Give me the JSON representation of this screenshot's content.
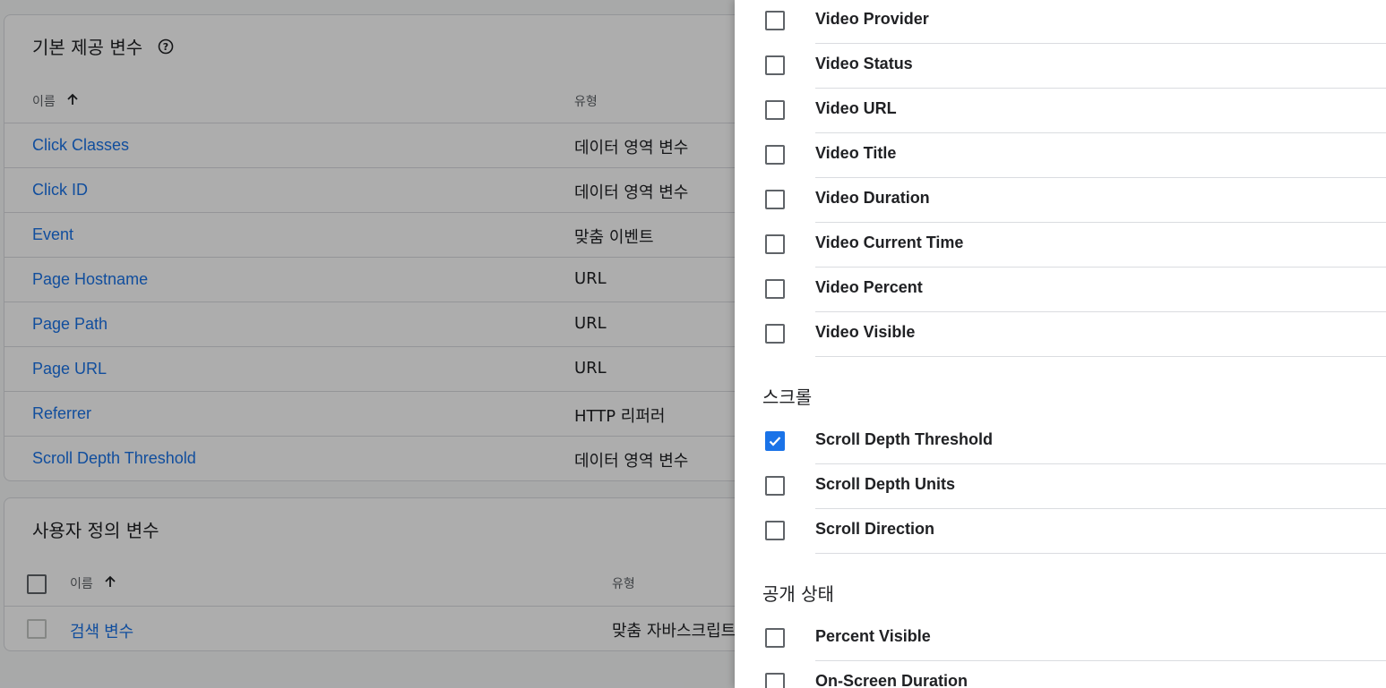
{
  "builtin": {
    "title": "기본 제공 변수",
    "col_name": "이름",
    "col_type": "유형",
    "rows": [
      {
        "name": "Click Classes",
        "type": "데이터 영역 변수"
      },
      {
        "name": "Click ID",
        "type": "데이터 영역 변수"
      },
      {
        "name": "Event",
        "type": "맞춤 이벤트"
      },
      {
        "name": "Page Hostname",
        "type": "URL"
      },
      {
        "name": "Page Path",
        "type": "URL"
      },
      {
        "name": "Page URL",
        "type": "URL"
      },
      {
        "name": "Referrer",
        "type": "HTTP 리퍼러"
      },
      {
        "name": "Scroll Depth Threshold",
        "type": "데이터 영역 변수"
      }
    ]
  },
  "custom": {
    "title": "사용자 정의 변수",
    "col_name": "이름",
    "col_type": "유형",
    "rows": [
      {
        "name": "검색 변수",
        "type": "맞춤 자바스크립트"
      }
    ]
  },
  "panel": {
    "video_items": [
      {
        "label": "Video Provider",
        "checked": false
      },
      {
        "label": "Video Status",
        "checked": false
      },
      {
        "label": "Video URL",
        "checked": false
      },
      {
        "label": "Video Title",
        "checked": false
      },
      {
        "label": "Video Duration",
        "checked": false
      },
      {
        "label": "Video Current Time",
        "checked": false
      },
      {
        "label": "Video Percent",
        "checked": false
      },
      {
        "label": "Video Visible",
        "checked": false
      }
    ],
    "scroll_section": "스크롤",
    "scroll_items": [
      {
        "label": "Scroll Depth Threshold",
        "checked": true
      },
      {
        "label": "Scroll Depth Units",
        "checked": false
      },
      {
        "label": "Scroll Direction",
        "checked": false
      }
    ],
    "visibility_section": "공개 상태",
    "visibility_items": [
      {
        "label": "Percent Visible",
        "checked": false
      },
      {
        "label": "On-Screen Duration",
        "checked": false
      }
    ]
  },
  "colors": {
    "accent": "#1a73e8",
    "link": "#1a73e8",
    "scrim": "rgba(0,0,0,0.32)"
  }
}
